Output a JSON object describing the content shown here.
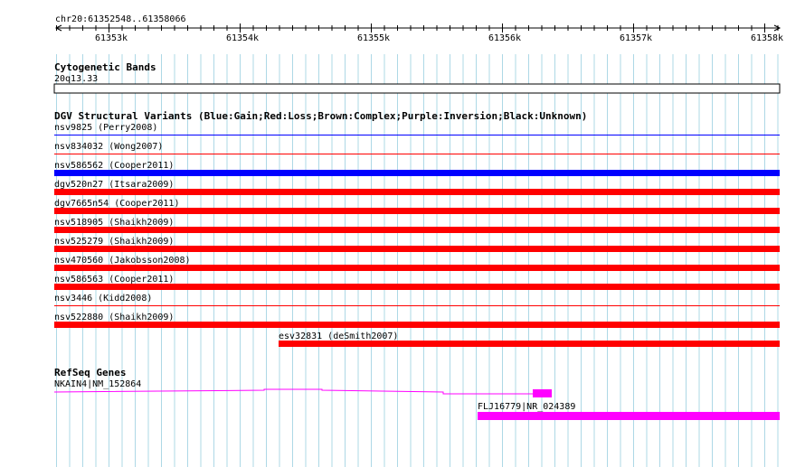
{
  "colors": {
    "grid": "#add8e6",
    "gain": "#0000ff",
    "loss": "#ff0000",
    "gene": "#ff00ff",
    "text": "#000000"
  },
  "ruler": {
    "label": "chr20:61352548..61358066",
    "ticks": [
      "61353k",
      "61354k",
      "61355k",
      "61356k",
      "61357k",
      "61358k"
    ]
  },
  "cytobands": {
    "title": "Cytogenetic Bands",
    "band": "20q13.33"
  },
  "dgv": {
    "title": "DGV Structural Variants (Blue:Gain;Red:Loss;Brown:Complex;Purple:Inversion;Black:Unknown)",
    "variants": [
      {
        "name": "nsv9825 (Perry2008)",
        "type": "gain",
        "display": "thin"
      },
      {
        "name": "nsv834032 (Wong2007)",
        "type": "loss",
        "display": "thin"
      },
      {
        "name": "nsv586562 (Cooper2011)",
        "type": "gain",
        "display": "thick"
      },
      {
        "name": "dgv520n27 (Itsara2009)",
        "type": "loss",
        "display": "thick"
      },
      {
        "name": "dgv7665n54 (Cooper2011)",
        "type": "loss",
        "display": "thick"
      },
      {
        "name": "nsv518905 (Shaikh2009)",
        "type": "loss",
        "display": "thick"
      },
      {
        "name": "nsv525279 (Shaikh2009)",
        "type": "loss",
        "display": "thick"
      },
      {
        "name": "nsv470560 (Jakobsson2008)",
        "type": "loss",
        "display": "thick"
      },
      {
        "name": "nsv586563 (Cooper2011)",
        "type": "loss",
        "display": "thick"
      },
      {
        "name": "nsv3446 (Kidd2008)",
        "type": "loss",
        "display": "thin"
      },
      {
        "name": "nsv522880 (Shaikh2009)",
        "type": "loss",
        "display": "thick"
      },
      {
        "name": "esv32831 (deSmith2007)",
        "type": "loss",
        "display": "thick",
        "partial": true
      }
    ]
  },
  "refseq": {
    "title": "RefSeq Genes",
    "genes": [
      {
        "name": "NKAIN4|NM_152864"
      },
      {
        "name": "FLJ16779|NR_024389"
      }
    ]
  }
}
